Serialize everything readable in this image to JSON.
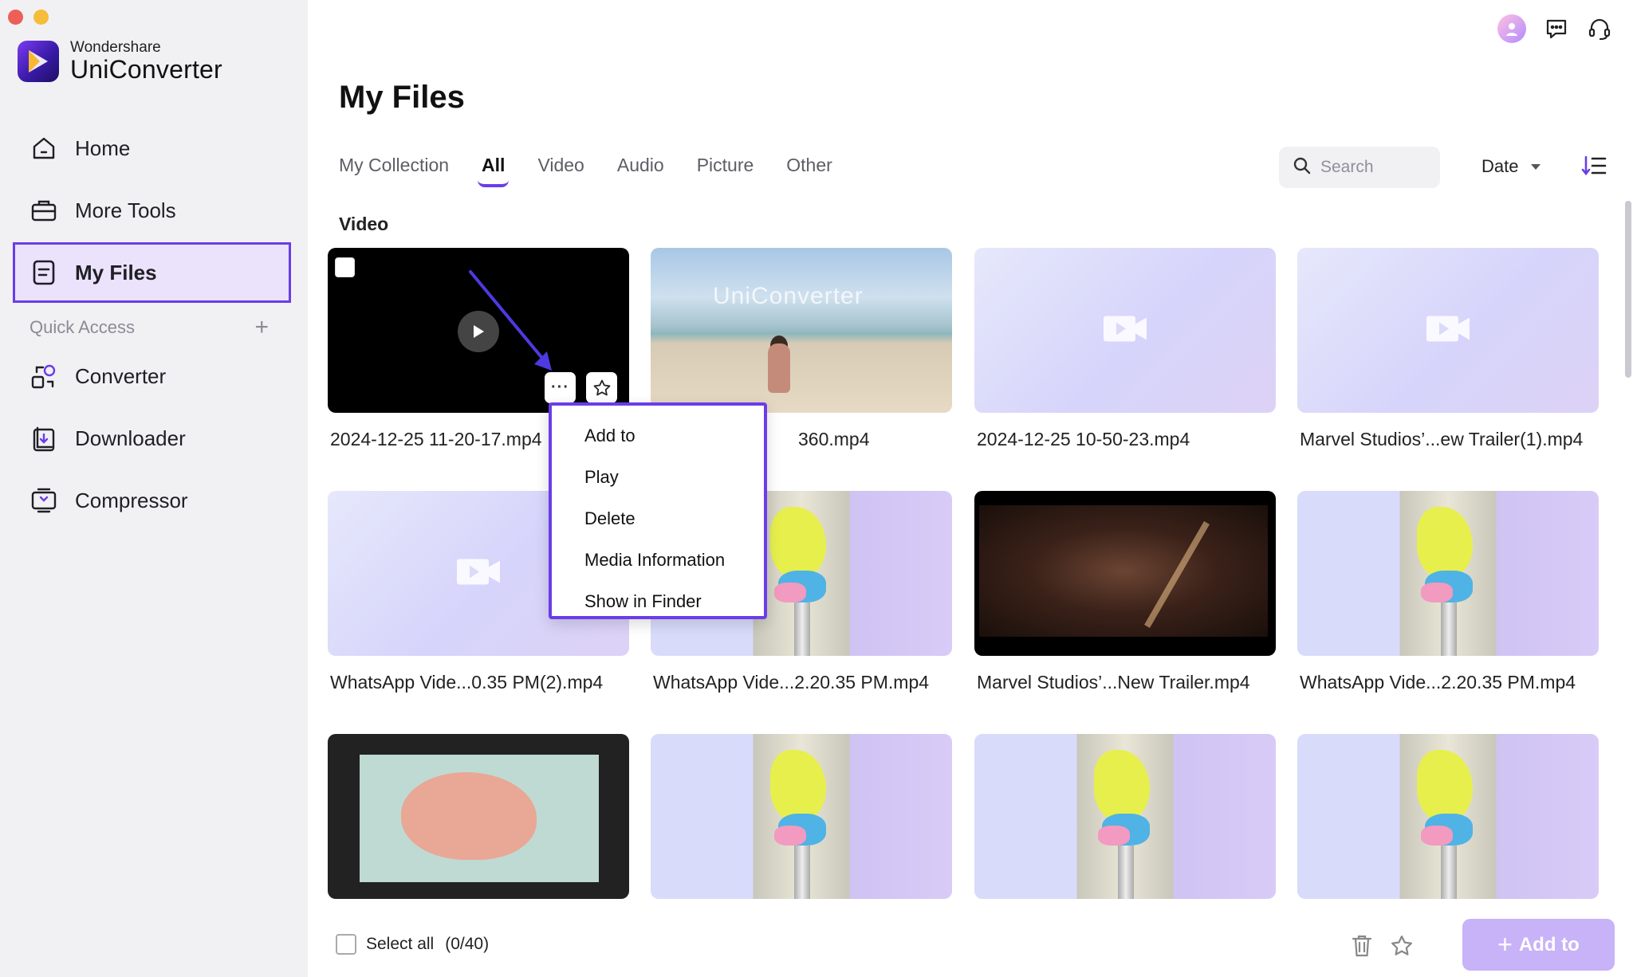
{
  "app": {
    "brand_small": "Wondershare",
    "brand_name": "UniConverter"
  },
  "sidebar": {
    "items": [
      {
        "label": "Home",
        "icon": "home-icon"
      },
      {
        "label": "More Tools",
        "icon": "toolbox-icon"
      },
      {
        "label": "My Files",
        "icon": "file-icon",
        "active": true
      }
    ],
    "quick_access_label": "Quick Access",
    "quick_access_add": "+",
    "quick_items": [
      {
        "label": "Converter",
        "icon": "converter-icon"
      },
      {
        "label": "Downloader",
        "icon": "downloader-icon"
      },
      {
        "label": "Compressor",
        "icon": "compressor-icon"
      }
    ]
  },
  "main": {
    "title": "My Files",
    "tabs": [
      {
        "label": "My Collection"
      },
      {
        "label": "All",
        "active": true
      },
      {
        "label": "Video"
      },
      {
        "label": "Audio"
      },
      {
        "label": "Picture"
      },
      {
        "label": "Other"
      }
    ],
    "search_placeholder": "Search",
    "sort_value": "Date",
    "section_label": "Video",
    "files": [
      {
        "name": "2024-12-25 11-20-17.mp4",
        "thumb": "dark-play"
      },
      {
        "name": "360.mp4",
        "thumb": "beach"
      },
      {
        "name": "2024-12-25 10-50-23.mp4",
        "thumb": "placeholder"
      },
      {
        "name": "Marvel Studios’...ew Trailer(1).mp4",
        "thumb": "placeholder"
      },
      {
        "name": "WhatsApp Vide...0.35 PM(2).mp4",
        "thumb": "placeholder"
      },
      {
        "name": "WhatsApp Vide...2.20.35 PM.mp4",
        "thumb": "candy"
      },
      {
        "name": "Marvel Studios’...New Trailer.mp4",
        "thumb": "movie"
      },
      {
        "name": "WhatsApp Vide...2.20.35 PM.mp4",
        "thumb": "candy"
      },
      {
        "name": "",
        "thumb": "brain"
      },
      {
        "name": "",
        "thumb": "candy"
      },
      {
        "name": "",
        "thumb": "candy"
      },
      {
        "name": "",
        "thumb": "candy"
      }
    ],
    "beach_watermark": "UniConverter",
    "more_button_label": "···"
  },
  "context_menu": {
    "items": [
      "Add to",
      "Play",
      "Delete",
      "Media Information",
      "Show in Finder"
    ]
  },
  "bottom_bar": {
    "select_all_label": "Select all",
    "selection_count": "(0/40)",
    "add_to_label": "Add to"
  },
  "colors": {
    "accent": "#6a3de8",
    "active_bg": "#ebe2fb",
    "sidebar_bg": "#f1f1f4",
    "add_button": "#c8b2f8"
  }
}
